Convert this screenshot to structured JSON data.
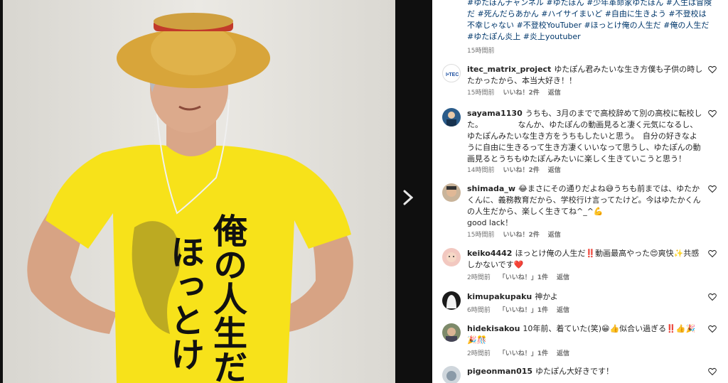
{
  "post": {
    "caption": "#ゆたぽんチャンネル #ゆたぽん #少年革命家ゆたぽん #人生は冒険だ #死んだらあかん #ハイサイまいど #自由に生きよう #不登校は不幸じゃない #不登校YouTuber #ほっとけ俺の人生だ #俺の人生だ #ゆたぽん炎上 #炎上youtuber",
    "time": "15時間前",
    "shirt_text": [
      "ほっとけ",
      "俺の人生だ"
    ]
  },
  "comments": [
    {
      "user": "itec_matrix_project",
      "text": "ゆたぽん君みたいな生き方僕も子供の時したかったから、本当大好き！！",
      "time": "15時間前",
      "likes": "いいね！2件",
      "reply": "返信"
    },
    {
      "user": "sayama1130",
      "text": "うちも、3月のまでで高校辞めて別の高校に転校した。　　　　　なんか、ゆたぽんの動画見ると凄く元気になるし、ゆたぽんみたいな生き方をうちもしたいと思う。　自分の好きなように自由に生きるって生き方凄くいいなって思うし、ゆたぽんの動画見るとうちもゆたぽんみたいに楽しく生きていこうと思う！",
      "time": "14時間前",
      "likes": "いいね！2件",
      "reply": "返信"
    },
    {
      "user": "shimada_w",
      "text": "😂まさにその通りだよね😅うちも前までは、ゆたかくんに、義務教育だから、学校行け言ってたけど。今はゆたかくんの人生だから、楽しく生きてね^_^💪",
      "text2": "good lack！",
      "time": "15時間前",
      "likes": "いいね！2件",
      "reply": "返信"
    },
    {
      "user": "keiko4442",
      "text": "ほっとけ俺の人生だ‼️動画最高やった😍爽快✨共感しかないです❤️",
      "time": "2時間前",
      "likes": "「いいね！」1件",
      "reply": "返信"
    },
    {
      "user": "kimupakupaku",
      "text": "神かよ",
      "time": "6時間前",
      "likes": "「いいね！」1件",
      "reply": "返信"
    },
    {
      "user": "hidekisakou",
      "text": "10年前、着ていた(笑)😁👍似合い過ぎる‼️👍🎉🎉🎊",
      "time": "2時間前",
      "likes": "「いいね！」1件",
      "reply": "返信"
    },
    {
      "user": "pigeonman015",
      "text": "ゆたぽん大好きです！"
    }
  ],
  "icons": {
    "next": "chevron-right-icon",
    "like": "heart-icon"
  },
  "colors": {
    "shirt": "#f7e21a",
    "hashtag": "#00376b",
    "heart_red": "#e0245e"
  }
}
